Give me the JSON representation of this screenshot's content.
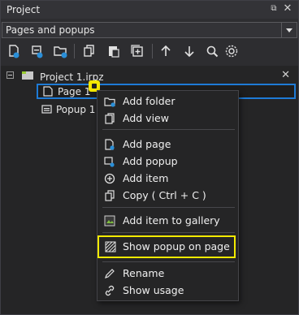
{
  "panel": {
    "title": "Project"
  },
  "selector": {
    "value": "Pages and popups"
  },
  "toolbar": {
    "icons": [
      "add-page-icon",
      "add-popup-icon",
      "add-folder-icon",
      "copy-icon",
      "paste-icon",
      "duplicate-icon",
      "move-up-icon",
      "move-down-icon",
      "search-icon",
      "settings-icon"
    ]
  },
  "tree": {
    "project": "Project 1.irpz",
    "items": [
      "Page 1",
      "Popup 1"
    ]
  },
  "menu": {
    "items": [
      {
        "label": "Add folder"
      },
      {
        "label": "Add view"
      },
      {
        "label": "Add page"
      },
      {
        "label": "Add popup"
      },
      {
        "label": "Add item"
      },
      {
        "label": "Copy ( Ctrl + C )"
      },
      {
        "label": "Add item to gallery"
      },
      {
        "label": "Show popup on page"
      },
      {
        "label": "Rename"
      },
      {
        "label": "Show usage"
      }
    ]
  },
  "colors": {
    "accent": "#1e7bd6",
    "highlight": "#f3ea00",
    "background": "#2d2d30"
  }
}
